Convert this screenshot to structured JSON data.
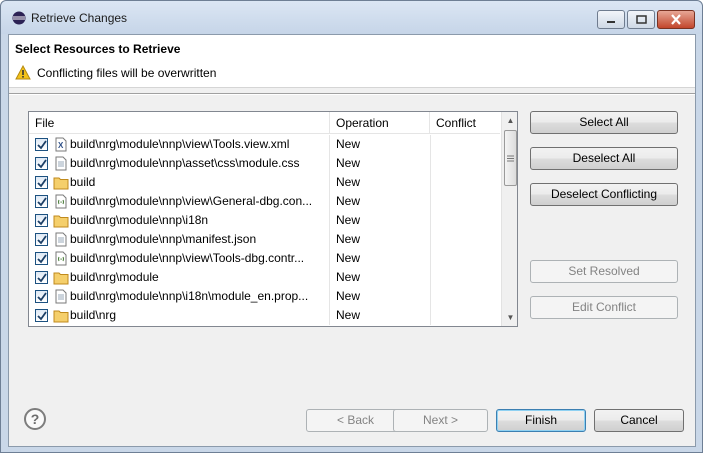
{
  "window": {
    "title": "Retrieve Changes"
  },
  "header": {
    "title": "Select Resources to Retrieve",
    "message": "Conflicting files will be overwritten"
  },
  "table": {
    "columns": [
      "File",
      "Operation",
      "Conflict"
    ],
    "rows": [
      {
        "icon": "xml-file-icon",
        "file": "build\\nrg\\module\\nnp\\view\\Tools.view.xml",
        "operation": "New",
        "conflict": "",
        "checked": true
      },
      {
        "icon": "text-file-icon",
        "file": "build\\nrg\\module\\nnp\\asset\\css\\module.css",
        "operation": "New",
        "conflict": "",
        "checked": true
      },
      {
        "icon": "folder-icon",
        "file": "build",
        "operation": "New",
        "conflict": "",
        "checked": true
      },
      {
        "icon": "js-file-icon",
        "file": "build\\nrg\\module\\nnp\\view\\General-dbg.con...",
        "operation": "New",
        "conflict": "",
        "checked": true
      },
      {
        "icon": "folder-icon",
        "file": "build\\nrg\\module\\nnp\\i18n",
        "operation": "New",
        "conflict": "",
        "checked": true
      },
      {
        "icon": "text-file-icon",
        "file": "build\\nrg\\module\\nnp\\manifest.json",
        "operation": "New",
        "conflict": "",
        "checked": true
      },
      {
        "icon": "js-file-icon",
        "file": "build\\nrg\\module\\nnp\\view\\Tools-dbg.contr...",
        "operation": "New",
        "conflict": "",
        "checked": true
      },
      {
        "icon": "folder-icon",
        "file": "build\\nrg\\module",
        "operation": "New",
        "conflict": "",
        "checked": true
      },
      {
        "icon": "text-file-icon",
        "file": "build\\nrg\\module\\nnp\\i18n\\module_en.prop...",
        "operation": "New",
        "conflict": "",
        "checked": true
      },
      {
        "icon": "folder-icon",
        "file": "build\\nrg",
        "operation": "New",
        "conflict": "",
        "checked": true
      }
    ]
  },
  "side_buttons": {
    "select_all": "Select All",
    "deselect_all": "Deselect All",
    "deselect_conflicting": "Deselect Conflicting",
    "set_resolved": "Set Resolved",
    "edit_conflict": "Edit Conflict"
  },
  "footer": {
    "help": "?",
    "back": "< Back",
    "next": "Next >",
    "finish": "Finish",
    "cancel": "Cancel"
  },
  "colors": {
    "accent": "#3c7fb1",
    "warning": "#f3c21a",
    "folder": "#e8b64a"
  }
}
